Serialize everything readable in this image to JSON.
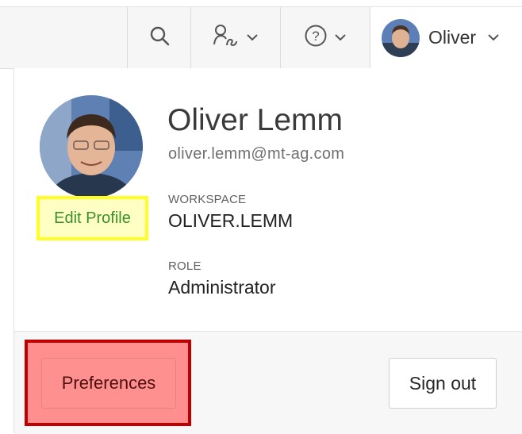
{
  "toolbar": {
    "search_icon": "search-icon",
    "admin_icon": "user-admin-icon",
    "help_icon": "help-icon",
    "user_name": "Oliver"
  },
  "profile": {
    "full_name": "Oliver Lemm",
    "email": "oliver.lemm@mt-ag.com",
    "edit_profile_label": "Edit Profile",
    "workspace_label": "WORKSPACE",
    "workspace_value": "OLIVER.LEMM",
    "role_label": "ROLE",
    "role_value": "Administrator"
  },
  "actions": {
    "preferences_label": "Preferences",
    "sign_out_label": "Sign out"
  },
  "colors": {
    "edit_profile_highlight": "#ffff26",
    "preferences_highlight": "#c00000",
    "edit_profile_text": "#3a8f2e"
  }
}
